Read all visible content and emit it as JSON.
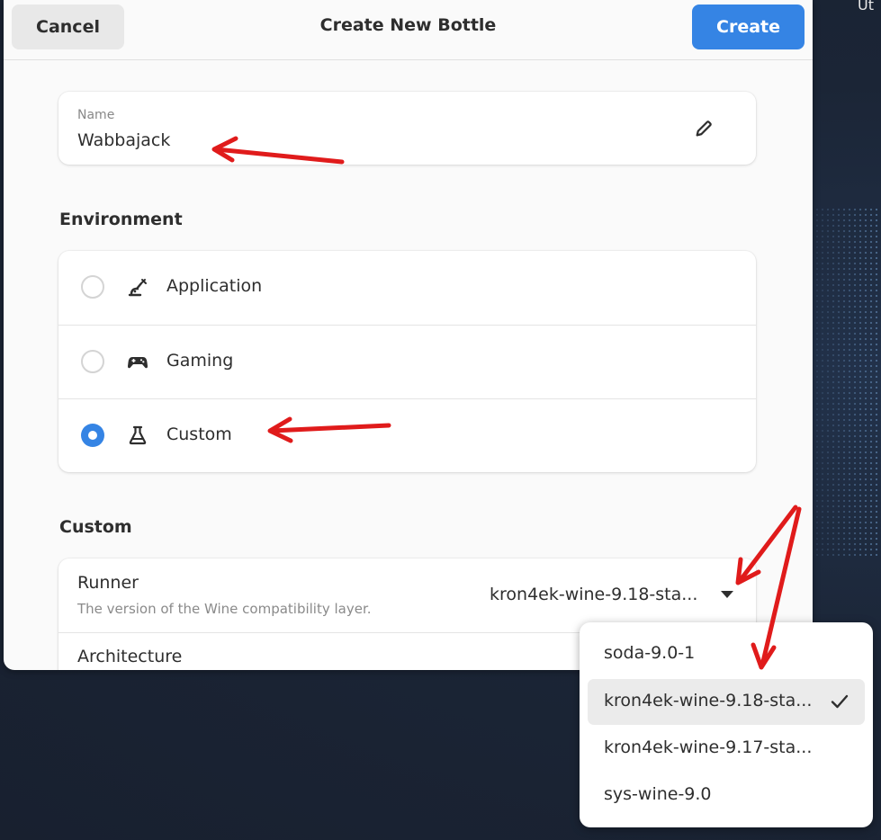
{
  "desktop": {
    "corner_text": "Ut"
  },
  "dialog": {
    "title": "Create New Bottle",
    "cancel_label": "Cancel",
    "create_label": "Create"
  },
  "name_field": {
    "label": "Name",
    "value": "Wabbajack",
    "icon": "pencil-icon"
  },
  "environment": {
    "title": "Environment",
    "selected": "Custom",
    "options": [
      {
        "label": "Application",
        "icon": "application-icon",
        "checked": false
      },
      {
        "label": "Gaming",
        "icon": "gamepad-icon",
        "checked": false
      },
      {
        "label": "Custom",
        "icon": "flask-icon",
        "checked": true
      }
    ]
  },
  "custom": {
    "title": "Custom",
    "runner_title": "Runner",
    "runner_subtitle": "The version of the Wine compatibility layer.",
    "runner_value": "kron4ek-wine-9.18-sta...",
    "architecture_title": "Architecture"
  },
  "runner_popover": {
    "items": [
      {
        "label": "soda-9.0-1",
        "selected": false
      },
      {
        "label": "kron4ek-wine-9.18-sta...",
        "selected": true
      },
      {
        "label": "kron4ek-wine-9.17-sta...",
        "selected": false
      },
      {
        "label": "sys-wine-9.0",
        "selected": false
      }
    ]
  },
  "colors": {
    "accent": "#3584e4",
    "annotation_arrow": "#e01b1b",
    "dialog_bg": "#fafafa",
    "card_bg": "#ffffff"
  }
}
